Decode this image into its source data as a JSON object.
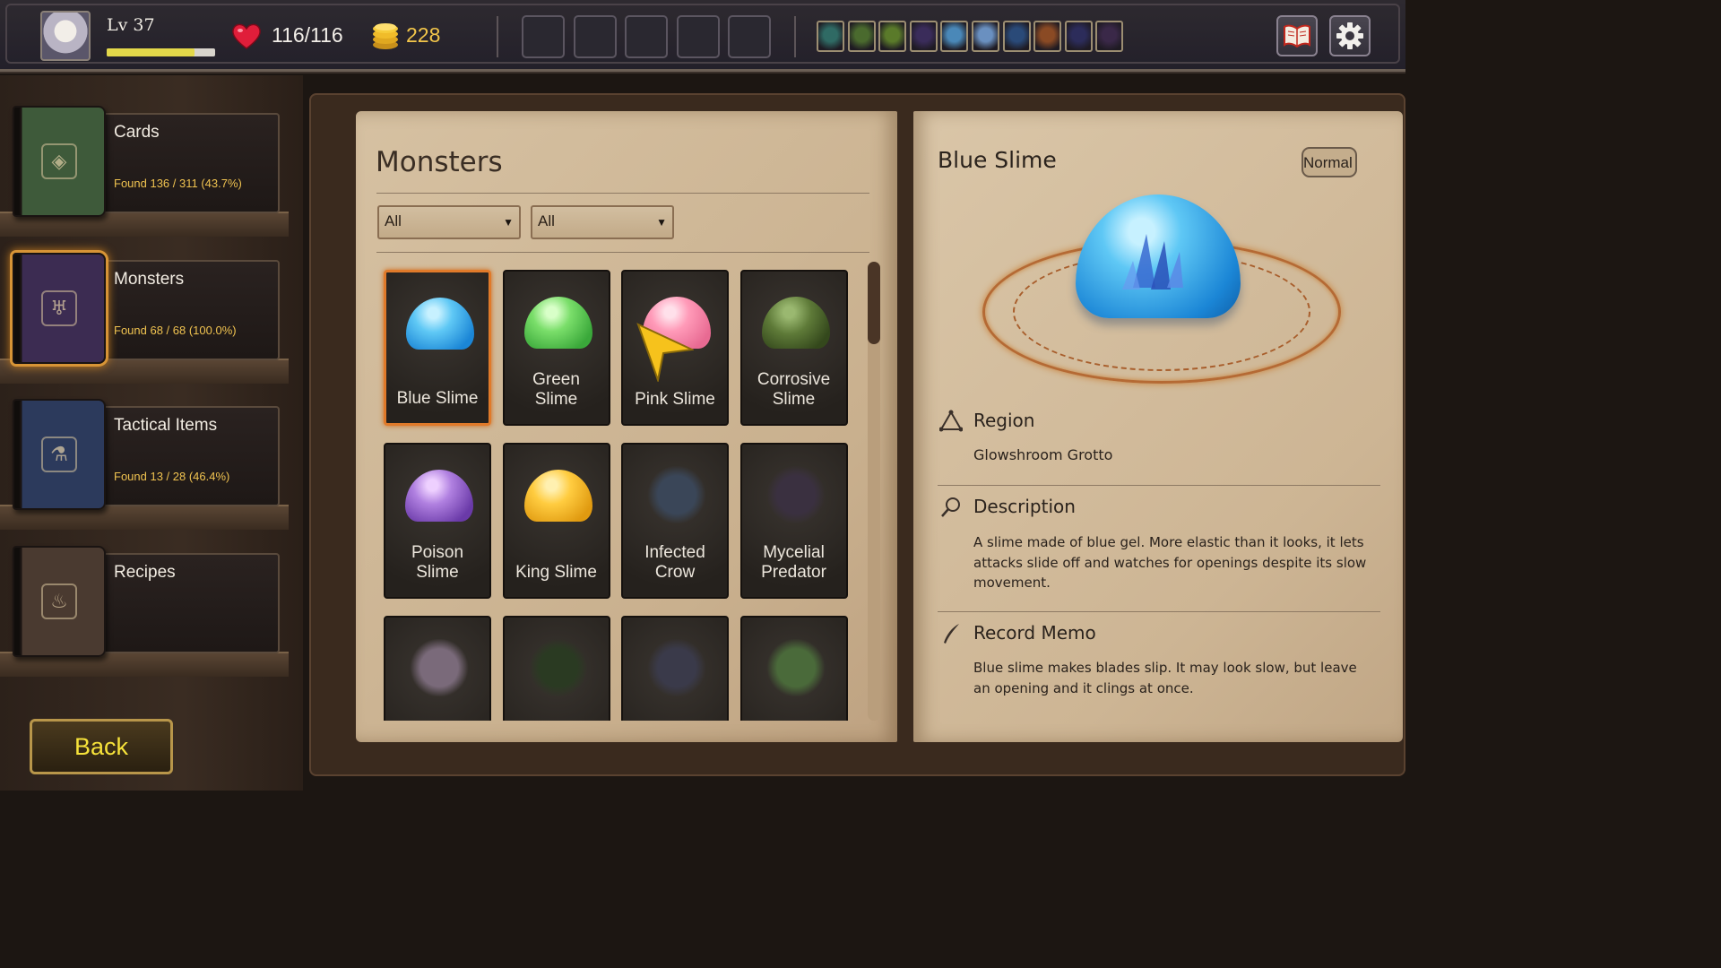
{
  "player": {
    "level_label": "Lv 37",
    "xp_fraction": 0.81,
    "hp": "116/116",
    "gold": "228"
  },
  "icons": {
    "heart": "heart-icon",
    "coin": "coin-stack-icon",
    "encyclopedia": "open-book-icon",
    "settings": "gear-icon"
  },
  "equip_slots": 5,
  "mini_cards": [
    "#2f6a64",
    "#4a6a2e",
    "#5a7a2a",
    "#3a2c5a",
    "#4a88b8",
    "#6a90c0",
    "#2a4a78",
    "#8a4a24",
    "#2c2c5a",
    "#3a2848"
  ],
  "categories": [
    {
      "title": "Cards",
      "found": "Found 136 / 311 (43.7%)",
      "color": "#3e5a3a",
      "emblem": "◈"
    },
    {
      "title": "Monsters",
      "found": "Found 68 / 68 (100.0%)",
      "color": "#3c2c52",
      "emblem": "♅"
    },
    {
      "title": "Tactical Items",
      "found": "Found 13 / 28 (46.4%)",
      "color": "#2c3a5c",
      "emblem": "⚗"
    },
    {
      "title": "Recipes",
      "found": "",
      "color": "#4a3a30",
      "emblem": "♨"
    }
  ],
  "back_label": "Back",
  "page_title": "Monsters",
  "filters": {
    "first": "All",
    "second": "All"
  },
  "monsters": [
    {
      "name": "Blue Slime",
      "selected": true
    },
    {
      "name": "Green Slime"
    },
    {
      "name": "Pink Slime"
    },
    {
      "name": "Corrosive Slime"
    },
    {
      "name": "Poison Slime"
    },
    {
      "name": "King Slime"
    },
    {
      "name": "Infected Crow"
    },
    {
      "name": "Mycelial Predator"
    },
    {
      "name": ""
    },
    {
      "name": ""
    },
    {
      "name": ""
    },
    {
      "name": ""
    }
  ],
  "detail": {
    "name": "Blue Slime",
    "rank": "Normal",
    "region_title": "Region",
    "region": "Glowshroom Grotto",
    "description_title": "Description",
    "description": "A slime made of blue gel. More elastic than it looks, it lets attacks slide off and watches for openings despite its slow movement.",
    "memo_title": "Record Memo",
    "memo": "Blue slime makes blades slip. It may look slow, but leave an opening and it clings at once."
  }
}
